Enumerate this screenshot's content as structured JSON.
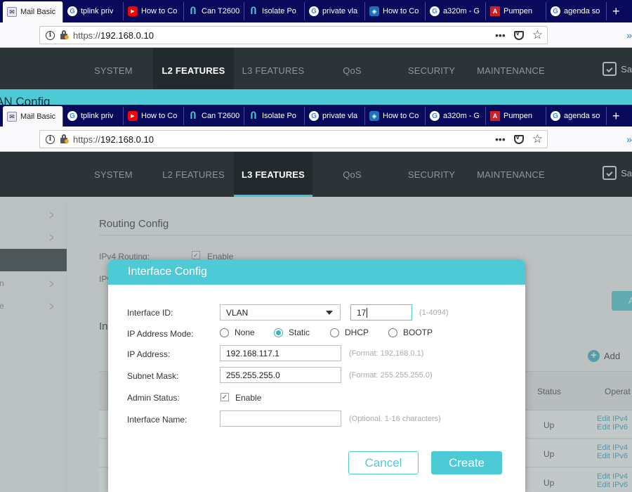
{
  "browser": {
    "tabs": [
      {
        "label": "Mail Basic",
        "icon": "mail-icon"
      },
      {
        "label": "tplink priv",
        "icon": "google-icon"
      },
      {
        "label": "How to Co",
        "icon": "youtube-icon"
      },
      {
        "label": "Can T2600",
        "icon": "tplink-icon"
      },
      {
        "label": "Isolate Po",
        "icon": "tplink-icon"
      },
      {
        "label": "private vla",
        "icon": "google-icon"
      },
      {
        "label": "How to Co",
        "icon": "shield-icon"
      },
      {
        "label": "a320m - G",
        "icon": "google-icon"
      },
      {
        "label": "Pumpen",
        "icon": "a-icon"
      },
      {
        "label": "agenda so",
        "icon": "google-icon"
      }
    ],
    "url_prefix": "https://",
    "url_host": "192.168.0.10",
    "more_label": "•••"
  },
  "app": {
    "menu_top": [
      "SYSTEM",
      "L2 FEATURES",
      "L3 FEATURES",
      "QoS",
      "SECURITY",
      "MAINTENANCE"
    ],
    "save_label": "Sa",
    "teal_banner": "AN Config",
    "routing_title": "Routing Config",
    "ipv4_routing_label": "IPv4 Routing:",
    "ipv4_enable_label": "Enable",
    "ipv_trunc": "IPv",
    "in_trunc": "In",
    "teal_btn_trunc": "A",
    "add_label": "Add",
    "table": {
      "status_header": "Status",
      "oper_header": "Operat",
      "rows": [
        {
          "status": "Up",
          "edit_ipv4": "Edit IPv4",
          "edit_ipv6": "Edit IPv6"
        },
        {
          "status": "Up",
          "edit_ipv4": "Edit IPv4",
          "edit_ipv6": "Edit IPv6"
        },
        {
          "status": "Up",
          "edit_ipv4": "Edit IPv4",
          "edit_ipv6": "Edit IPv6"
        }
      ]
    }
  },
  "modal": {
    "title": "Interface Config",
    "interface_id_label": "Interface ID:",
    "interface_type": "VLAN",
    "interface_id_value": "17",
    "interface_id_hint": "(1-4094)",
    "ip_mode_label": "IP Address Mode:",
    "modes": [
      "None",
      "Static",
      "DHCP",
      "BOOTP"
    ],
    "selected_mode": "Static",
    "ip_address_label": "IP Address:",
    "ip_address_value": "192.168.117.1",
    "ip_address_hint": "(Format: 192.168.0.1)",
    "subnet_label": "Subnet Mask:",
    "subnet_value": "255.255.255.0",
    "subnet_hint": "(Format: 255.255.255.0)",
    "admin_status_label": "Admin Status:",
    "admin_enable_label": "Enable",
    "admin_enabled": true,
    "interface_name_label": "Interface Name:",
    "interface_name_value": "",
    "interface_name_hint": "(Optional. 1-16 characters)",
    "cancel_label": "Cancel",
    "create_label": "Create"
  },
  "colors": {
    "accent": "#4ecad7",
    "header": "#2c3438",
    "tabbar": "#0a0a5c"
  }
}
